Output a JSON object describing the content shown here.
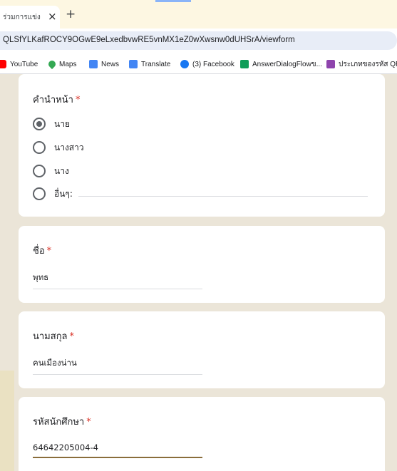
{
  "browser": {
    "tab_title": "ร่วมการแข่ง",
    "tab_close": "×",
    "new_tab": "+",
    "url": "QLSfYLKafROCY9OGwE9eLxedbvwRE5vnMX1eZ0wXwsnw0dUHSrA/viewform"
  },
  "bookmarks": [
    {
      "label": "YouTube",
      "color": "#ff0000",
      "icon": "youtube-icon"
    },
    {
      "label": "Maps",
      "color": "#34a853",
      "icon": "map-pin-icon"
    },
    {
      "label": "News",
      "color": "#4285f4",
      "icon": "news-icon"
    },
    {
      "label": "Translate",
      "color": "#4285f4",
      "icon": "translate-icon"
    },
    {
      "label": "(3) Facebook",
      "color": "#1877f2",
      "icon": "facebook-icon"
    },
    {
      "label": "AnswerDialogFlowข...",
      "color": "#0f9d58",
      "icon": "plus-square-icon"
    },
    {
      "label": "ประเภทของรหัส QR |",
      "color": "#8e44ad",
      "icon": "qr-icon"
    }
  ],
  "form": {
    "required_marker": "*",
    "title_question": {
      "title": "คำนำหน้า",
      "options": [
        "นาย",
        "นางสาว",
        "นาง",
        "อื่นๆ:"
      ],
      "selected": "นาย"
    },
    "first_name": {
      "title": "ชื่อ",
      "value": "พุทธ"
    },
    "last_name": {
      "title": "นามสกุล",
      "value": "คนเมืองน่าน"
    },
    "student_id": {
      "title": "รหัสนักศึกษา",
      "value": "64642205004-4"
    }
  }
}
